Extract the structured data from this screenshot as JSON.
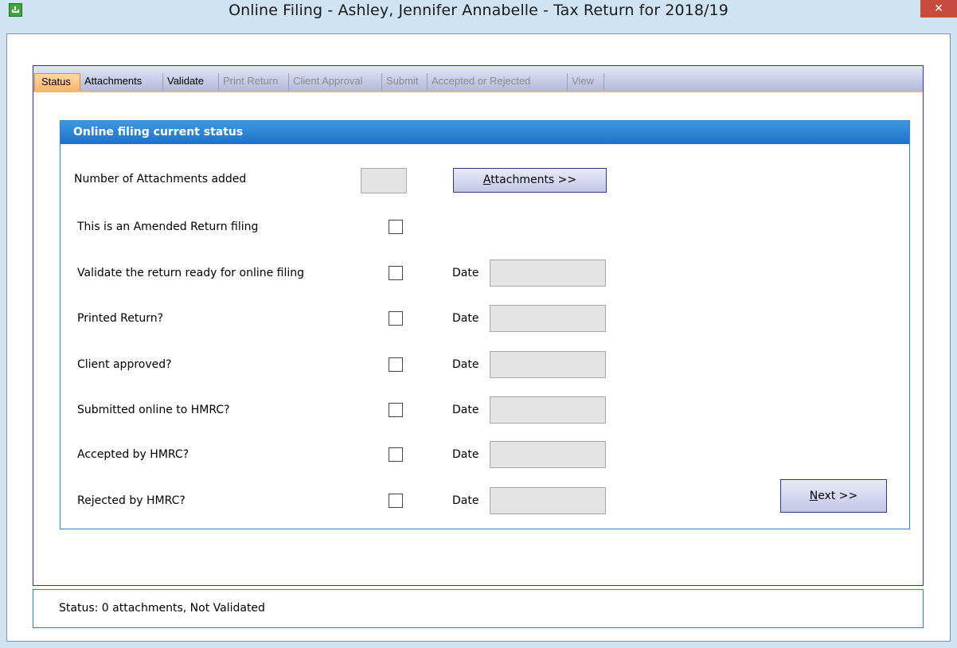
{
  "window": {
    "title": "Online Filing - Ashley, Jennifer Annabelle - Tax Return for 2018/19",
    "close_glyph": "✕"
  },
  "tabs": [
    {
      "label": "Status",
      "state": "active"
    },
    {
      "label": "Attachments",
      "state": "enabled"
    },
    {
      "label": "Validate",
      "state": "enabled"
    },
    {
      "label": "Print Return",
      "state": "disabled"
    },
    {
      "label": "Client Approval",
      "state": "disabled"
    },
    {
      "label": "Submit",
      "state": "disabled"
    },
    {
      "label": "Accepted or Rejected",
      "state": "disabled"
    },
    {
      "label": "View",
      "state": "disabled"
    }
  ],
  "group": {
    "title": "Online filing current status",
    "attachments_label": "Number of Attachments added",
    "attachments_count": "",
    "attachments_button_prefix": "",
    "attachments_button_hotkey": "A",
    "attachments_button_rest": "ttachments >>",
    "amended_label": "This is an Amended Return filing",
    "amended_checked": false,
    "date_label": "Date",
    "rows": [
      {
        "label": "Validate the return ready for online filing",
        "checked": false,
        "date": ""
      },
      {
        "label": "Printed Return?",
        "checked": false,
        "date": ""
      },
      {
        "label": "Client approved?",
        "checked": false,
        "date": ""
      },
      {
        "label": "Submitted online to HMRC?",
        "checked": false,
        "date": ""
      },
      {
        "label": "Accepted by HMRC?",
        "checked": false,
        "date": ""
      },
      {
        "label": "Rejected by HMRC?",
        "checked": false,
        "date": ""
      }
    ],
    "next_button_hotkey": "N",
    "next_button_rest": "ext >>"
  },
  "status_bar": {
    "text": "Status: 0 attachments, Not Validated"
  },
  "colors": {
    "tab_active": "#ffb469",
    "group_header": "#1f72c7",
    "close_button": "#c74a3f"
  }
}
